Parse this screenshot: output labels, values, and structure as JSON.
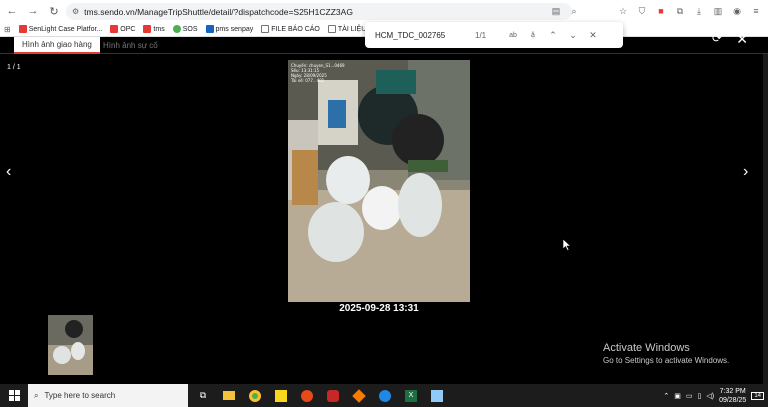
{
  "browser": {
    "url": "tms.sendo.vn/ManageTripShuttle/detail/?dispatchcode=S25H1CZZ3AG",
    "bookmarks": [
      {
        "label": "SenLight Case Platfor...",
        "color": "#e53935"
      },
      {
        "label": "OPC",
        "color": "#e53935"
      },
      {
        "label": "tms",
        "color": "#e53935"
      },
      {
        "label": "SOS",
        "color": "#4caf50"
      },
      {
        "label": "pms senpay",
        "color": "#1565c0"
      },
      {
        "label": "FILE BÁO CÁO",
        "color": "#757575"
      },
      {
        "label": "TÀI LIỆU",
        "color": "#757575"
      }
    ]
  },
  "find": {
    "query": "HCM_TDC_002765",
    "count": "1/1",
    "opt_case": "ab",
    "opt_diacritic": "ặ"
  },
  "viewer": {
    "tab_delivery": "Hình ảnh giao hàng",
    "tab_incident": "Hình ảnh sự cố",
    "counter": "1 / 1",
    "caption": "2025-09-28 13:31",
    "photo_overlay": [
      "Chuyến: chuyen_S1...0469",
      "Sếu: 13:31:15",
      "Ngày: 28/09/2025",
      "Tài xế: 077...401"
    ]
  },
  "windows": {
    "activate_title": "Activate Windows",
    "activate_sub": "Go to Settings to activate Windows.",
    "search_placeholder": "Type here to search",
    "time": "7:32 PM",
    "date": "09/28/25",
    "notif_count": "14"
  }
}
